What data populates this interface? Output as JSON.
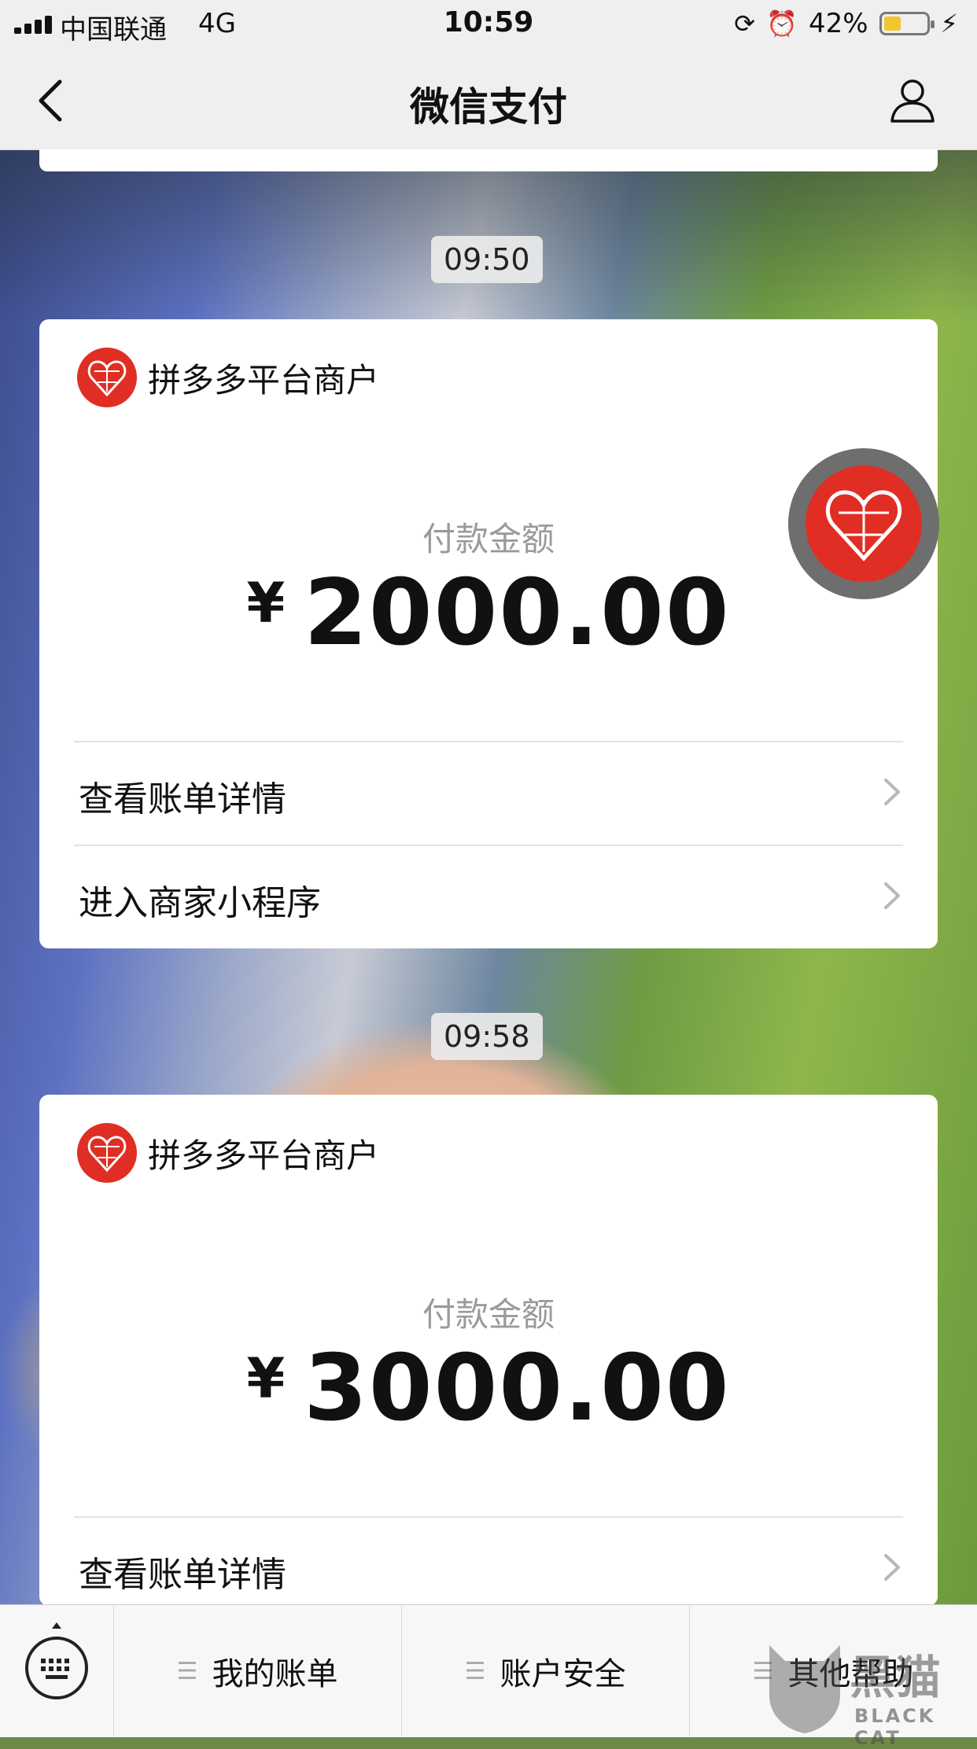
{
  "status_bar": {
    "carrier": "中国联通",
    "network": "4G",
    "time": "10:59",
    "battery_percent": "42%",
    "battery_level": 0.42
  },
  "nav": {
    "title": "微信支付"
  },
  "messages": [
    {
      "time": "09:50",
      "merchant": "拼多多平台商户",
      "amount_label": "付款金额",
      "currency": "¥",
      "amount": "2000.00",
      "rows": [
        "查看账单详情",
        "进入商家小程序"
      ]
    },
    {
      "time": "09:58",
      "merchant": "拼多多平台商户",
      "amount_label": "付款金额",
      "currency": "¥",
      "amount": "3000.00",
      "rows": [
        "查看账单详情"
      ]
    }
  ],
  "tabbar": {
    "tabs": [
      "我的账单",
      "账户安全",
      "其他帮助"
    ]
  },
  "watermark": {
    "cn": "黑猫",
    "en": "BLACK CAT"
  },
  "colors": {
    "brand_red": "#e02e24",
    "battery_yellow": "#f2c531"
  },
  "icons": {
    "back": "chevron-left-icon",
    "profile": "person-icon",
    "keyboard": "keyboard-icon",
    "merchant_logo": "pinduoduo-logo-icon"
  }
}
